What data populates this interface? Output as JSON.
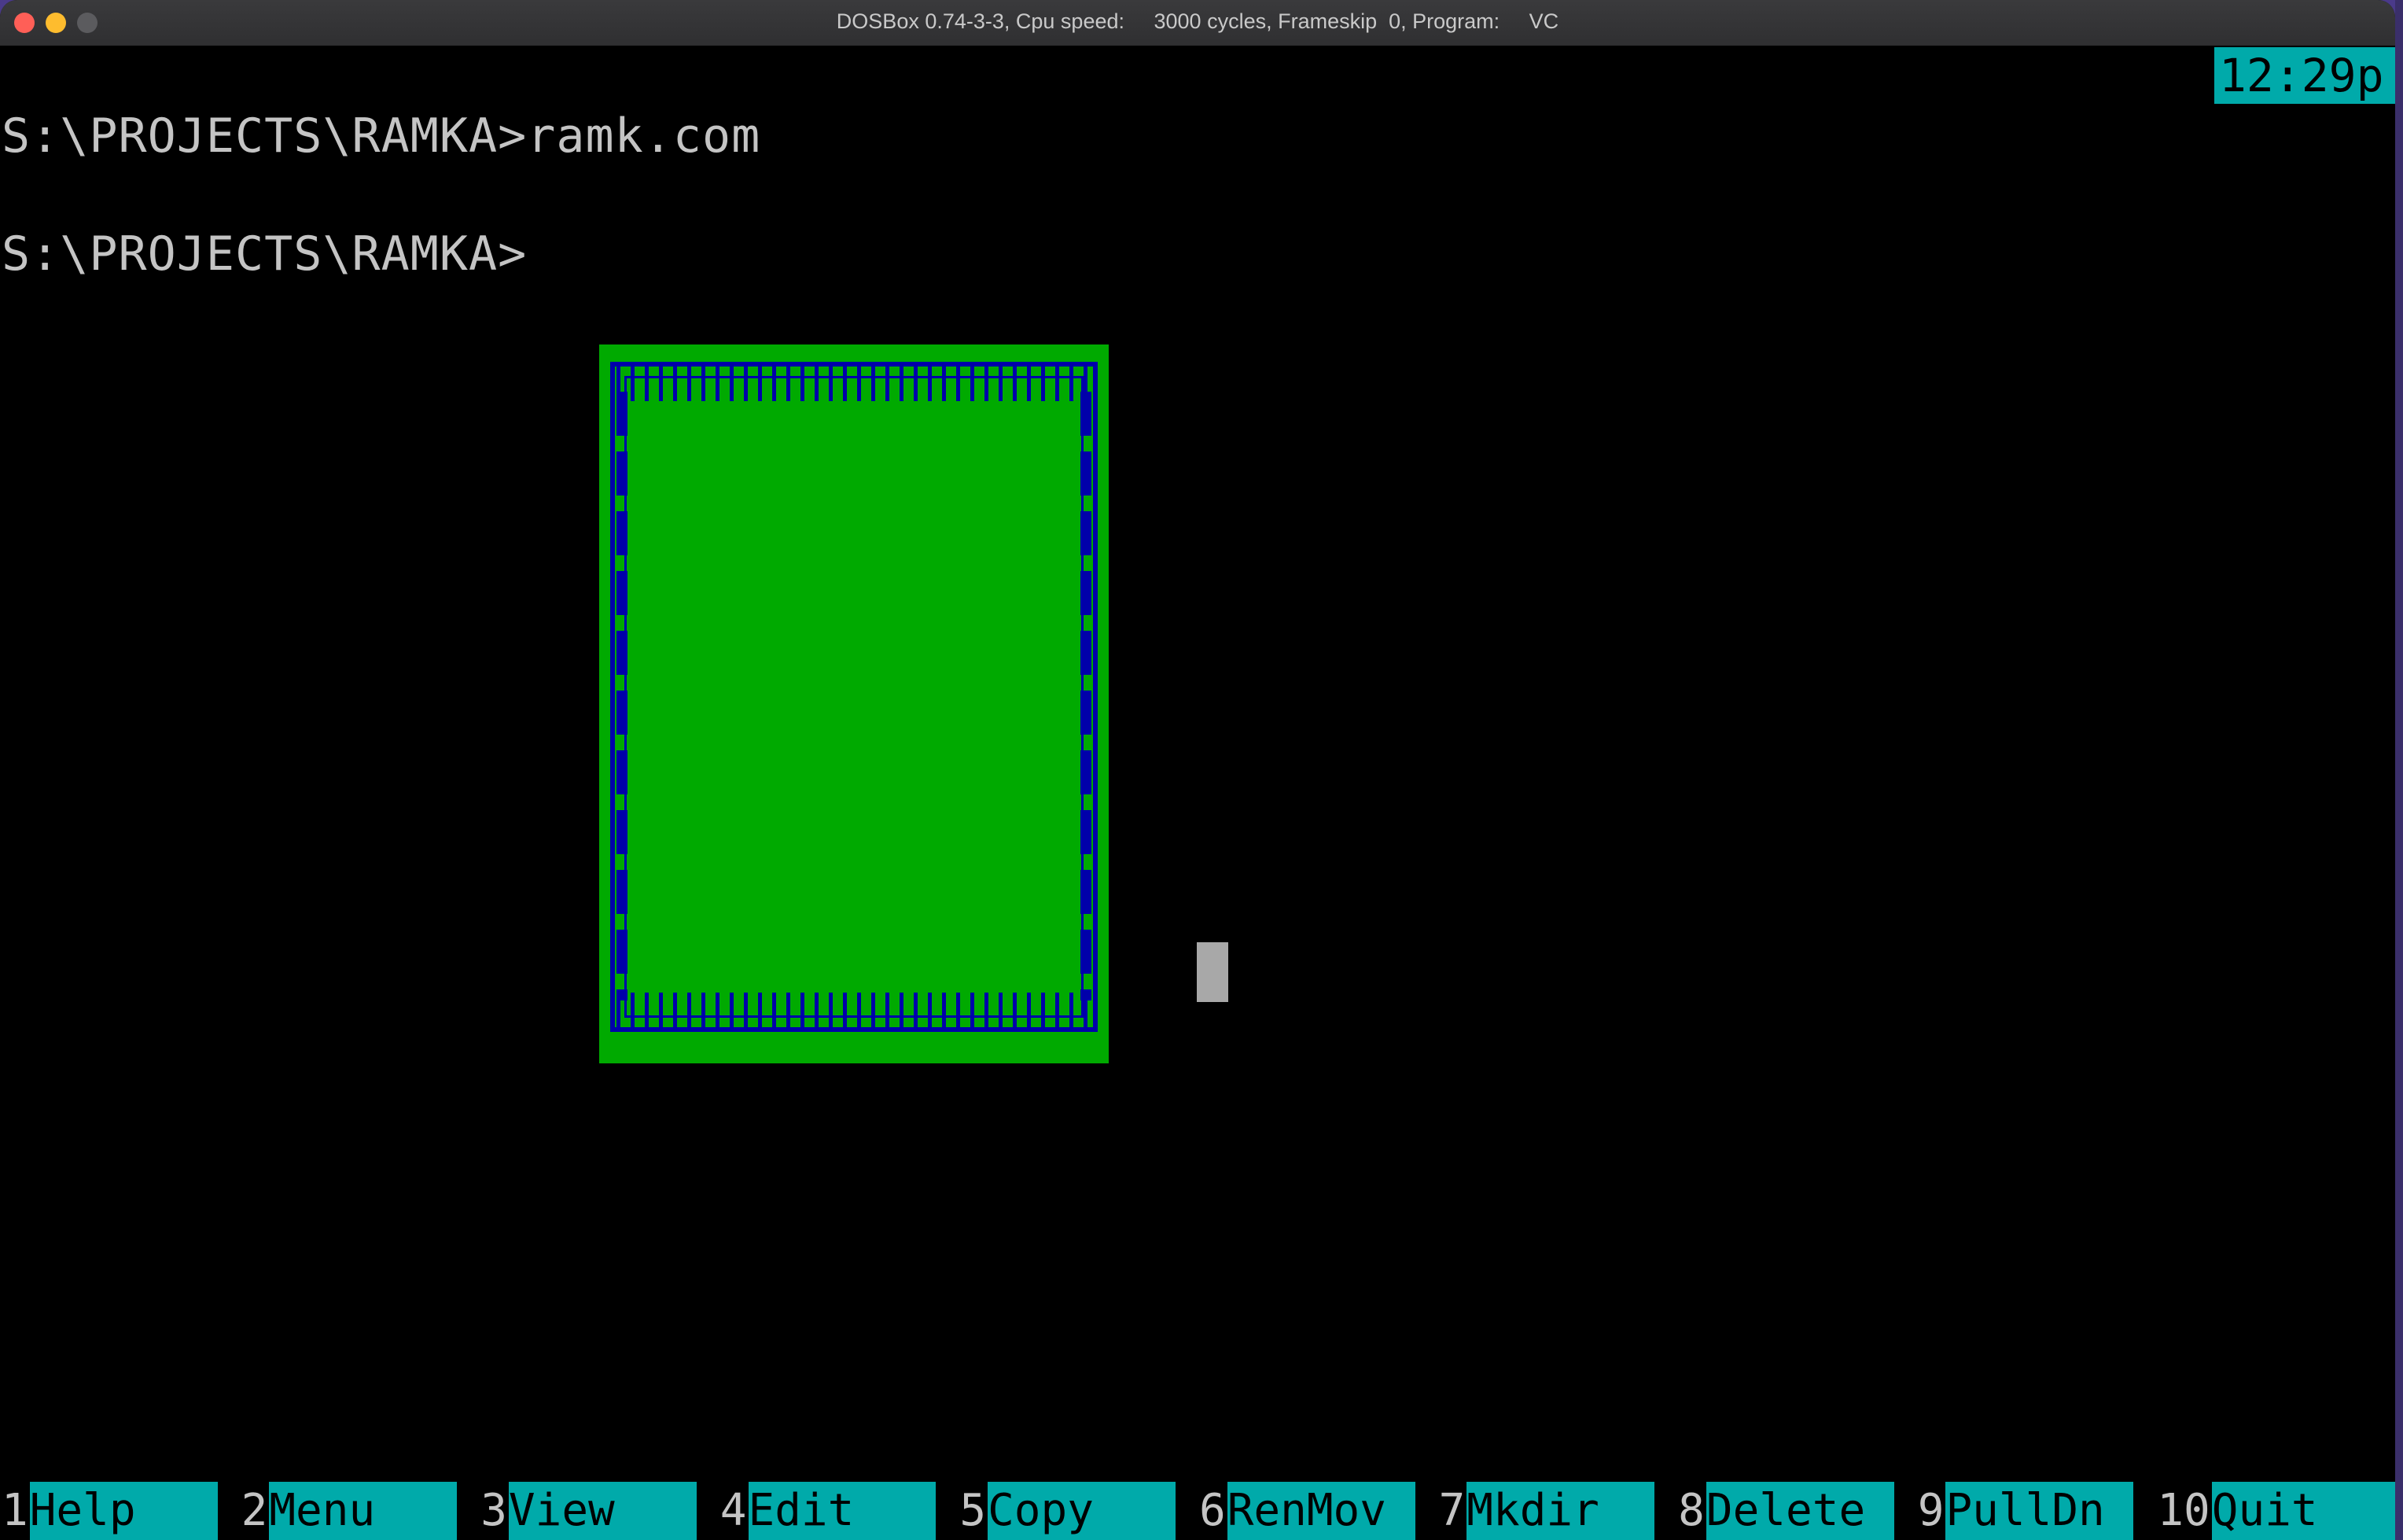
{
  "window": {
    "title": "DOSBox 0.74-3-3, Cpu speed:     3000 cycles, Frameskip  0, Program:     VC"
  },
  "screen": {
    "lines": [
      "S:\\PROJECTS\\RAMKA>ramk.com",
      "S:\\PROJECTS\\RAMKA>"
    ],
    "clock": "12:29p"
  },
  "colors": {
    "frame_fill": "#00aa00",
    "frame_border": "#0000aa",
    "keybar_label": "#00aaaa",
    "text": "#c4c4c4"
  },
  "keybar": [
    {
      "num": "1",
      "label": "Help"
    },
    {
      "num": "2",
      "label": "Menu"
    },
    {
      "num": "3",
      "label": "View"
    },
    {
      "num": "4",
      "label": "Edit"
    },
    {
      "num": "5",
      "label": "Copy"
    },
    {
      "num": "6",
      "label": "RenMov"
    },
    {
      "num": "7",
      "label": "Mkdir"
    },
    {
      "num": "8",
      "label": "Delete"
    },
    {
      "num": "9",
      "label": "PullDn"
    },
    {
      "num": "10",
      "label": "Quit"
    }
  ]
}
